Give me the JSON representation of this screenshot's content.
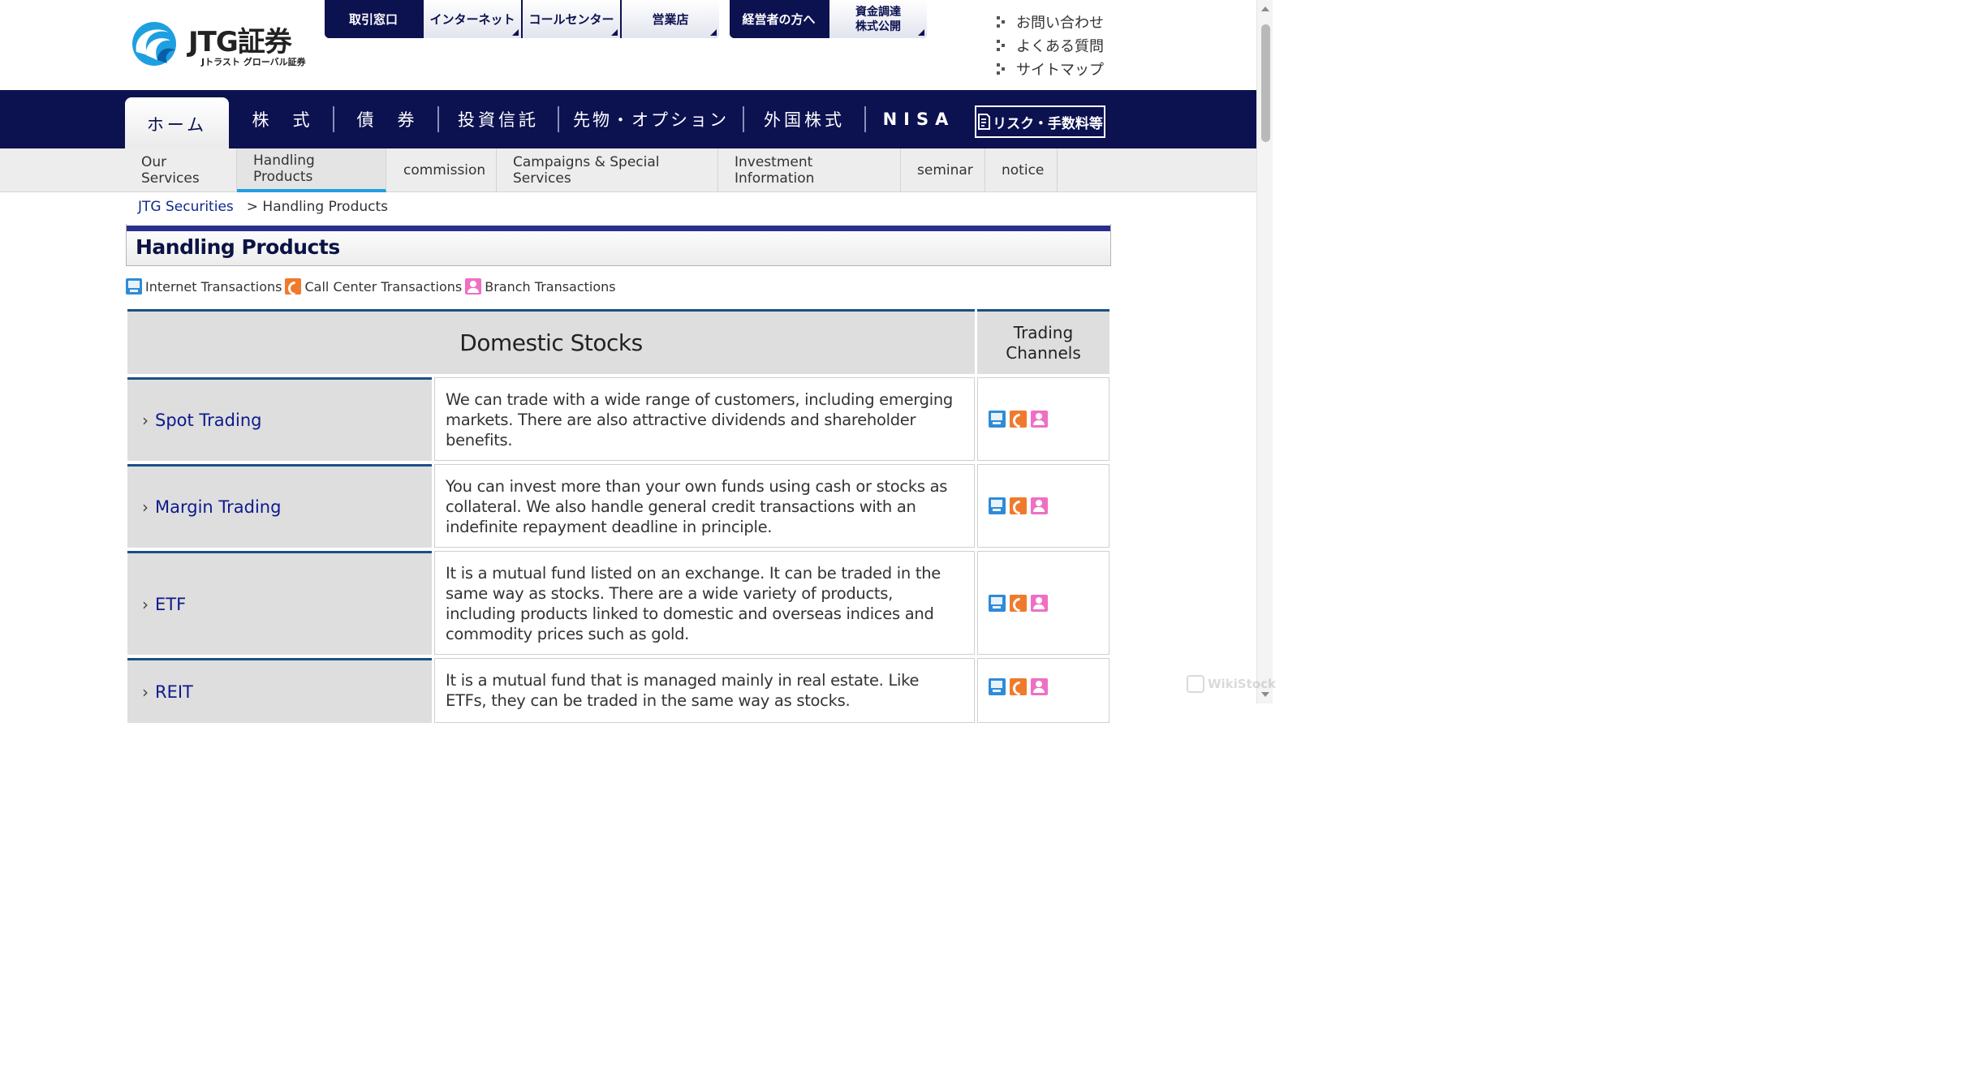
{
  "brand": {
    "logo_main": "JTG証券",
    "logo_sub": "Jトラスト グローバル証券",
    "logo_colors": [
      "#1ea0e0",
      "#0a5ea8"
    ]
  },
  "top_buttons": [
    {
      "label": "取引窓口",
      "style": "dark"
    },
    {
      "label": "インターネット",
      "style": "light"
    },
    {
      "label": "コールセンター",
      "style": "light"
    },
    {
      "label": "営業店",
      "style": "light"
    },
    {
      "label": "経営者の方へ",
      "style": "dark"
    },
    {
      "label": "資金調達\n株式公開",
      "style": "light"
    }
  ],
  "util_links": [
    "お問い合わせ",
    "よくある質問",
    "サイトマップ"
  ],
  "main_nav": {
    "items": [
      "ホーム",
      "株　式",
      "債　券",
      "投資信託",
      "先物・オプション",
      "外国株式",
      "NISA"
    ],
    "active": "ホーム",
    "risk_button": "リスク・手数料等"
  },
  "sub_nav": {
    "items": [
      "Our Services",
      "Handling Products",
      "commission",
      "Campaigns & Special Services",
      "Investment Information",
      "seminar",
      "notice"
    ],
    "active": "Handling Products"
  },
  "breadcrumb": {
    "home": "JTG Securities",
    "current": "> Handling Products"
  },
  "page_title": "Handling Products",
  "legend": [
    {
      "icon": "internet-icon",
      "label": "Internet Transactions"
    },
    {
      "icon": "call-center-icon",
      "label": "Call Center Transactions"
    },
    {
      "icon": "branch-icon",
      "label": "Branch Transactions"
    }
  ],
  "table": {
    "header": "Domestic Stocks",
    "channels_header": "Trading Channels",
    "rows": [
      {
        "name": "Spot Trading",
        "description": "We can trade with a wide range of customers, including emerging markets. There are also attractive dividends and shareholder benefits.",
        "channels": [
          "internet",
          "call",
          "branch"
        ]
      },
      {
        "name": "Margin Trading",
        "description": "You can invest more than your own funds using cash or stocks as collateral. We also handle general credit transactions with an indefinite repayment deadline in principle.",
        "channels": [
          "internet",
          "call",
          "branch"
        ]
      },
      {
        "name": "ETF",
        "description": "It is a mutual fund listed on an exchange. It can be traded in the same way as stocks. There are a wide variety of products, including products linked to domestic and overseas indices and commodity prices such as gold.",
        "channels": [
          "internet",
          "call",
          "branch"
        ]
      },
      {
        "name": "REIT",
        "description": "It is a mutual fund that is managed mainly in real estate. Like ETFs, they can be traded in the same way as stocks.",
        "channels": [
          "internet",
          "call",
          "branch"
        ]
      }
    ]
  },
  "colors": {
    "nav_bg": "#0c1150",
    "table_accent": "#1c4f86",
    "link": "#0d1a8a",
    "subnav_active": "#1ea0e0"
  },
  "watermark": "WikiStock"
}
